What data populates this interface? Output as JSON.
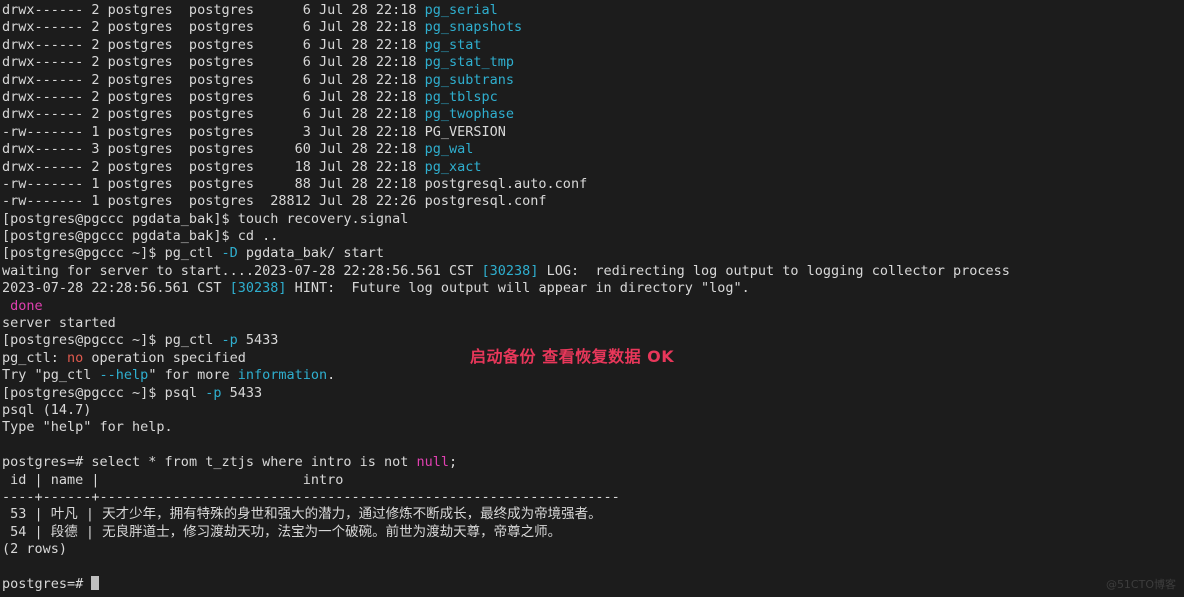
{
  "terminal": {
    "background_color": "#1c1c1c",
    "default_text_color": "#d8d8d8",
    "accent_cyan": "#2fafcf",
    "accent_magenta": "#e040b0",
    "accent_red": "#e05a4e",
    "annotation_color": "#e8375a",
    "watermark_color": "#3d3d3d"
  },
  "listing": {
    "rows": [
      {
        "perms": "drwx------",
        "links": "2",
        "owner": "postgres",
        "group": "postgres",
        "size": "6",
        "month": "Jul",
        "day": "28",
        "time": "22:18",
        "name": "pg_serial",
        "name_color": "cyan"
      },
      {
        "perms": "drwx------",
        "links": "2",
        "owner": "postgres",
        "group": "postgres",
        "size": "6",
        "month": "Jul",
        "day": "28",
        "time": "22:18",
        "name": "pg_snapshots",
        "name_color": "cyan"
      },
      {
        "perms": "drwx------",
        "links": "2",
        "owner": "postgres",
        "group": "postgres",
        "size": "6",
        "month": "Jul",
        "day": "28",
        "time": "22:18",
        "name": "pg_stat",
        "name_color": "cyan"
      },
      {
        "perms": "drwx------",
        "links": "2",
        "owner": "postgres",
        "group": "postgres",
        "size": "6",
        "month": "Jul",
        "day": "28",
        "time": "22:18",
        "name": "pg_stat_tmp",
        "name_color": "cyan"
      },
      {
        "perms": "drwx------",
        "links": "2",
        "owner": "postgres",
        "group": "postgres",
        "size": "6",
        "month": "Jul",
        "day": "28",
        "time": "22:18",
        "name": "pg_subtrans",
        "name_color": "cyan"
      },
      {
        "perms": "drwx------",
        "links": "2",
        "owner": "postgres",
        "group": "postgres",
        "size": "6",
        "month": "Jul",
        "day": "28",
        "time": "22:18",
        "name": "pg_tblspc",
        "name_color": "cyan"
      },
      {
        "perms": "drwx------",
        "links": "2",
        "owner": "postgres",
        "group": "postgres",
        "size": "6",
        "month": "Jul",
        "day": "28",
        "time": "22:18",
        "name": "pg_twophase",
        "name_color": "cyan"
      },
      {
        "perms": "-rw-------",
        "links": "1",
        "owner": "postgres",
        "group": "postgres",
        "size": "3",
        "month": "Jul",
        "day": "28",
        "time": "22:18",
        "name": "PG_VERSION",
        "name_color": "default"
      },
      {
        "perms": "drwx------",
        "links": "3",
        "owner": "postgres",
        "group": "postgres",
        "size": "60",
        "month": "Jul",
        "day": "28",
        "time": "22:18",
        "name": "pg_wal",
        "name_color": "cyan"
      },
      {
        "perms": "drwx------",
        "links": "2",
        "owner": "postgres",
        "group": "postgres",
        "size": "18",
        "month": "Jul",
        "day": "28",
        "time": "22:18",
        "name": "pg_xact",
        "name_color": "cyan"
      },
      {
        "perms": "-rw-------",
        "links": "1",
        "owner": "postgres",
        "group": "postgres",
        "size": "88",
        "month": "Jul",
        "day": "28",
        "time": "22:18",
        "name": "postgresql.auto.conf",
        "name_color": "default"
      },
      {
        "perms": "-rw-------",
        "links": "1",
        "owner": "postgres",
        "group": "postgres",
        "size": "28812",
        "month": "Jul",
        "day": "28",
        "time": "22:26",
        "name": "postgresql.conf",
        "name_color": "default"
      }
    ]
  },
  "session": {
    "prompt_bak": "[postgres@pgccc pgdata_bak]$ ",
    "prompt_home": "[postgres@pgccc ~]$ ",
    "prompt_psql": "postgres=# ",
    "cmd_touch": "touch recovery.signal",
    "cmd_cd": "cd ..",
    "cmd_pgctl_start_a": "pg_ctl ",
    "cmd_pgctl_start_flag": "-D",
    "cmd_pgctl_start_b": " pgdata_bak/ start",
    "waiting_text": "waiting for server to start....2023-07-28 22:28:56.561 CST ",
    "waiting_pid": "[30238]",
    "waiting_tail": " LOG:  redirecting log output to logging collector process",
    "hint_head": "2023-07-28 22:28:56.561 CST ",
    "hint_pid": "[30238]",
    "hint_tail": " HINT:  Future log output will appear in directory \"log\".",
    "done_text": " done",
    "server_started": "server started",
    "cmd_pgctl_p_a": "pg_ctl ",
    "cmd_pgctl_p_flag": "-p",
    "cmd_pgctl_p_b": " 5433",
    "err_head": "pg_ctl: ",
    "err_no": "no",
    "err_tail": " operation specified",
    "try_head": "Try \"pg_ctl ",
    "try_help": "--help",
    "try_mid": "\" for more ",
    "try_info": "information",
    "try_tail": ".",
    "cmd_psql_a": "psql ",
    "cmd_psql_flag": "-p",
    "cmd_psql_b": " 5433",
    "psql_version": "psql (14.7)",
    "psql_help": "Type \"help\" for help."
  },
  "query": {
    "sql_head": "select * from t_ztjs where intro is not ",
    "sql_null": "null",
    "sql_tail": ";",
    "header_row": " id | name |                         intro",
    "separator_row": "----+------+----------------------------------------------------------------",
    "rows": [
      {
        "id": "53",
        "name": "叶凡",
        "intro": "天才少年，拥有特殊的身世和强大的潜力，通过修炼不断成长，最终成为帝境强者。"
      },
      {
        "id": "54",
        "name": "段德",
        "intro": "无良胖道士，修习渡劫天功，法宝为一个破碗。前世为渡劫天尊，帝尊之师。"
      }
    ],
    "row_count_text": "(2 rows)"
  },
  "annotation": {
    "text": "启动备份 查看恢复数据 OK"
  },
  "watermark": {
    "text": "@51CTO博客"
  }
}
